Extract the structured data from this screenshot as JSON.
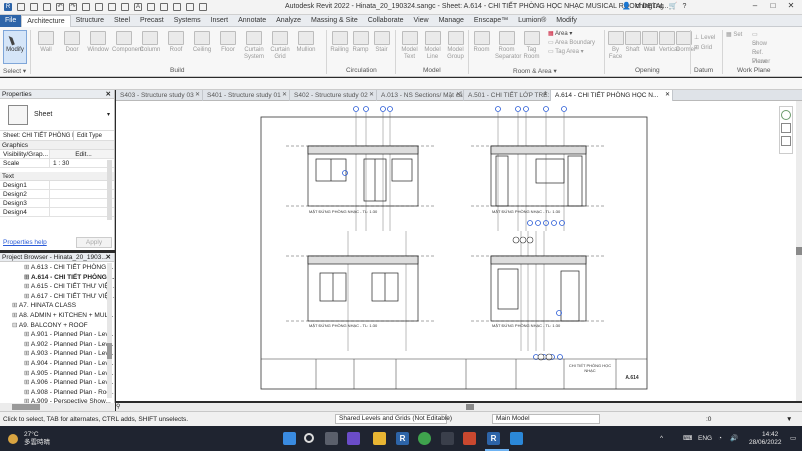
{
  "titlebar": {
    "title": "Autodesk Revit 2022 - Hinata_20_190324.sangc - Sheet: A.614 - CHI TIẾT PHÒNG HỌC NHẠC MUSICAL ROOM DETAI...",
    "user": "chingi.ng",
    "help": "?"
  },
  "ribbon_tabs": [
    "File",
    "Architecture",
    "Structure",
    "Steel",
    "Precast",
    "Systems",
    "Insert",
    "Annotate",
    "Analyze",
    "Massing & Site",
    "Collaborate",
    "View",
    "Manage",
    "Enscape™",
    "Lumion®",
    "Modify"
  ],
  "ribbon": {
    "modify": "Modify",
    "select": "Select",
    "build_buttons": [
      "Wall",
      "Door",
      "Window",
      "Component",
      "Column",
      "Roof",
      "Ceiling",
      "Floor",
      "Curtain System",
      "Curtain Grid",
      "Mullion"
    ],
    "circulation_buttons": [
      "Railing",
      "Ramp",
      "Stair"
    ],
    "model_buttons": [
      "Model Text",
      "Model Line",
      "Model Group"
    ],
    "room_buttons": [
      "Room",
      "Room Separator",
      "Tag Room"
    ],
    "area_buttons": [
      "Area",
      "Area Boundary",
      "Tag Area"
    ],
    "opening_buttons": [
      "By Face",
      "Shaft",
      "Wall",
      "Vertical",
      "Dormer"
    ],
    "datum_buttons": [
      "Level",
      "Grid"
    ],
    "workplane_buttons": [
      "Set",
      "Show",
      "Ref. Plane",
      "Viewer"
    ],
    "groups": [
      "Build",
      "Circulation",
      "Model",
      "Room & Area",
      "Opening",
      "Datum",
      "Work Plane"
    ]
  },
  "properties": {
    "header": "Properties",
    "type": "Sheet",
    "selector": "Sheet: CHI TIẾT PHÒNG H",
    "edit_type": "Edit Type",
    "section_graphics": "Graphics",
    "rows": [
      {
        "k": "Visibility/Grap...",
        "v": "Edit..."
      },
      {
        "k": "Scale",
        "v": "1 : 30"
      }
    ],
    "section_text": "Text",
    "text_rows": [
      "Design1",
      "Design2",
      "Design3",
      "Design4"
    ],
    "help_link": "Properties help",
    "apply": "Apply"
  },
  "browser": {
    "header": "Project Browser - Hinata_20_1903...",
    "items": [
      {
        "label": "A.613 - CHI TIẾT PHÒNG ...",
        "bold": false
      },
      {
        "label": "A.614 - CHI TIẾT PHÒNG ...",
        "bold": true
      },
      {
        "label": "A.615 - CHI TIẾT THƯ VIỆ...",
        "bold": false
      },
      {
        "label": "A.617 - CHI TIẾT THƯ VIỆ...",
        "bold": false
      },
      {
        "label": "A7. HINATA CLASS",
        "bold": false
      },
      {
        "label": "A8. ADMIN + KITCHEN + MUL...",
        "bold": false
      },
      {
        "label": "A9. BALCONY + ROOF",
        "bold": false
      },
      {
        "label": "A.901 - Planned Plan - Lev...",
        "bold": false
      },
      {
        "label": "A.902 - Planned Plan - Lev...",
        "bold": false
      },
      {
        "label": "A.903 - Planned Plan - Lev...",
        "bold": false
      },
      {
        "label": "A.904 - Planned Plan - Lev...",
        "bold": false
      },
      {
        "label": "A.905 - Planned Plan - Lev...",
        "bold": false
      },
      {
        "label": "A.906 - Planned Plan - Lev...",
        "bold": false
      },
      {
        "label": "A.908 - Planned Plan - Roo...",
        "bold": false
      },
      {
        "label": "A.909 - Perspective Show...",
        "bold": false
      }
    ]
  },
  "view_tabs": [
    {
      "label": "S403 - Structure study 03",
      "active": false
    },
    {
      "label": "S401 - Structure study 01",
      "active": false
    },
    {
      "label": "S402 - Structure study 02",
      "active": false
    },
    {
      "label": "A.013 - NS Sections/ Mặt cắt lắc N...",
      "active": false
    },
    {
      "label": "A.501 - CHI TIẾT LỚP TRẺ: 12-24 T...",
      "active": false
    },
    {
      "label": "A.614 - CHI TIẾT PHÒNG HỌC N...",
      "active": true
    }
  ],
  "sheet": {
    "drawing_caption_1": "MẶT ĐỨNG PHÒNG NHẠC - TL: 1:30",
    "drawing_caption_2": "MẶT ĐỨNG PHÒNG NHẠC - TL: 1:30",
    "drawing_caption_3": "MẶT ĐỨNG PHÒNG NHẠC - TL: 1:30",
    "drawing_caption_4": "MẶT ĐỨNG PHÒNG NHẠC - TL: 1:30",
    "title_block_name": "CHI TIẾT PHÒNG HỌC NHẠC",
    "sheet_number": "A.614"
  },
  "statusbar": {
    "message": "Click to select, TAB for alternates, CTRL adds, SHIFT unselects.",
    "workset": "Shared Levels and Grids (Not Editable)",
    "model": "Main Model",
    "scale_zero": ":0"
  },
  "taskbar": {
    "weather_temp": "27°C",
    "weather_desc": "多雲時晴",
    "time": "14:42",
    "date": "28/06/2022",
    "lang": "ENG"
  },
  "colors": {
    "file_tab": "#2d64a8",
    "taskbar": "#1f2430",
    "selection_blue": "#2a5bd7"
  }
}
